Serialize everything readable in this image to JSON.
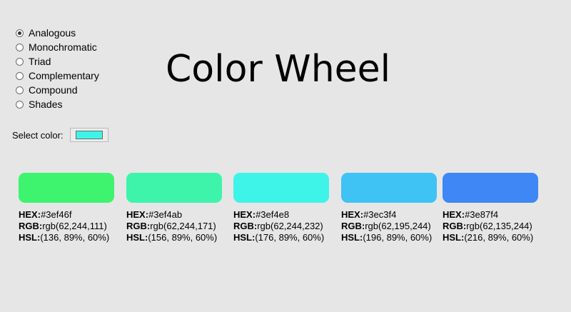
{
  "radio_options": [
    {
      "label": "Analogous",
      "checked": true
    },
    {
      "label": "Monochromatic",
      "checked": false
    },
    {
      "label": "Triad",
      "checked": false
    },
    {
      "label": "Complementary",
      "checked": false
    },
    {
      "label": "Compound",
      "checked": false
    },
    {
      "label": "Shades",
      "checked": false
    }
  ],
  "title": "Color Wheel",
  "select": {
    "label": "Select color:",
    "value": "#3ef4e8"
  },
  "labels": {
    "hex": "HEX:",
    "rgb": "RGB:",
    "hsl": "HSL:"
  },
  "swatches": [
    {
      "color": "#3ef46f",
      "hex": "#3ef46f",
      "rgb": "rgb(62,244,111)",
      "hsl": "(136, 89%, 60%)"
    },
    {
      "color": "#3ef4ab",
      "hex": "#3ef4ab",
      "rgb": "rgb(62,244,171)",
      "hsl": "(156, 89%, 60%)"
    },
    {
      "color": "#3ef4e8",
      "hex": "#3ef4e8",
      "rgb": "rgb(62,244,232)",
      "hsl": "(176, 89%, 60%)"
    },
    {
      "color": "#3ec3f4",
      "hex": "#3ec3f4",
      "rgb": "rgb(62,195,244)",
      "hsl": "(196, 89%, 60%)"
    },
    {
      "color": "#3e87f4",
      "hex": "#3e87f4",
      "rgb": "rgb(62,135,244)",
      "hsl": "(216, 89%, 60%)"
    }
  ]
}
